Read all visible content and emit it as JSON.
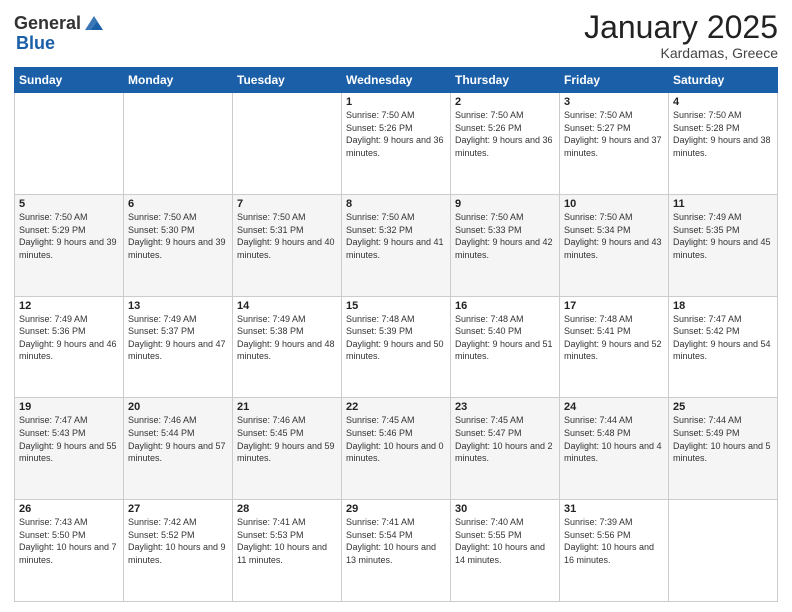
{
  "header": {
    "logo_general": "General",
    "logo_blue": "Blue",
    "title": "January 2025",
    "subtitle": "Kardamas, Greece"
  },
  "days_of_week": [
    "Sunday",
    "Monday",
    "Tuesday",
    "Wednesday",
    "Thursday",
    "Friday",
    "Saturday"
  ],
  "weeks": [
    [
      {
        "day": "",
        "info": ""
      },
      {
        "day": "",
        "info": ""
      },
      {
        "day": "",
        "info": ""
      },
      {
        "day": "1",
        "info": "Sunrise: 7:50 AM\nSunset: 5:26 PM\nDaylight: 9 hours\nand 36 minutes."
      },
      {
        "day": "2",
        "info": "Sunrise: 7:50 AM\nSunset: 5:26 PM\nDaylight: 9 hours\nand 36 minutes."
      },
      {
        "day": "3",
        "info": "Sunrise: 7:50 AM\nSunset: 5:27 PM\nDaylight: 9 hours\nand 37 minutes."
      },
      {
        "day": "4",
        "info": "Sunrise: 7:50 AM\nSunset: 5:28 PM\nDaylight: 9 hours\nand 38 minutes."
      }
    ],
    [
      {
        "day": "5",
        "info": "Sunrise: 7:50 AM\nSunset: 5:29 PM\nDaylight: 9 hours\nand 39 minutes."
      },
      {
        "day": "6",
        "info": "Sunrise: 7:50 AM\nSunset: 5:30 PM\nDaylight: 9 hours\nand 39 minutes."
      },
      {
        "day": "7",
        "info": "Sunrise: 7:50 AM\nSunset: 5:31 PM\nDaylight: 9 hours\nand 40 minutes."
      },
      {
        "day": "8",
        "info": "Sunrise: 7:50 AM\nSunset: 5:32 PM\nDaylight: 9 hours\nand 41 minutes."
      },
      {
        "day": "9",
        "info": "Sunrise: 7:50 AM\nSunset: 5:33 PM\nDaylight: 9 hours\nand 42 minutes."
      },
      {
        "day": "10",
        "info": "Sunrise: 7:50 AM\nSunset: 5:34 PM\nDaylight: 9 hours\nand 43 minutes."
      },
      {
        "day": "11",
        "info": "Sunrise: 7:49 AM\nSunset: 5:35 PM\nDaylight: 9 hours\nand 45 minutes."
      }
    ],
    [
      {
        "day": "12",
        "info": "Sunrise: 7:49 AM\nSunset: 5:36 PM\nDaylight: 9 hours\nand 46 minutes."
      },
      {
        "day": "13",
        "info": "Sunrise: 7:49 AM\nSunset: 5:37 PM\nDaylight: 9 hours\nand 47 minutes."
      },
      {
        "day": "14",
        "info": "Sunrise: 7:49 AM\nSunset: 5:38 PM\nDaylight: 9 hours\nand 48 minutes."
      },
      {
        "day": "15",
        "info": "Sunrise: 7:48 AM\nSunset: 5:39 PM\nDaylight: 9 hours\nand 50 minutes."
      },
      {
        "day": "16",
        "info": "Sunrise: 7:48 AM\nSunset: 5:40 PM\nDaylight: 9 hours\nand 51 minutes."
      },
      {
        "day": "17",
        "info": "Sunrise: 7:48 AM\nSunset: 5:41 PM\nDaylight: 9 hours\nand 52 minutes."
      },
      {
        "day": "18",
        "info": "Sunrise: 7:47 AM\nSunset: 5:42 PM\nDaylight: 9 hours\nand 54 minutes."
      }
    ],
    [
      {
        "day": "19",
        "info": "Sunrise: 7:47 AM\nSunset: 5:43 PM\nDaylight: 9 hours\nand 55 minutes."
      },
      {
        "day": "20",
        "info": "Sunrise: 7:46 AM\nSunset: 5:44 PM\nDaylight: 9 hours\nand 57 minutes."
      },
      {
        "day": "21",
        "info": "Sunrise: 7:46 AM\nSunset: 5:45 PM\nDaylight: 9 hours\nand 59 minutes."
      },
      {
        "day": "22",
        "info": "Sunrise: 7:45 AM\nSunset: 5:46 PM\nDaylight: 10 hours\nand 0 minutes."
      },
      {
        "day": "23",
        "info": "Sunrise: 7:45 AM\nSunset: 5:47 PM\nDaylight: 10 hours\nand 2 minutes."
      },
      {
        "day": "24",
        "info": "Sunrise: 7:44 AM\nSunset: 5:48 PM\nDaylight: 10 hours\nand 4 minutes."
      },
      {
        "day": "25",
        "info": "Sunrise: 7:44 AM\nSunset: 5:49 PM\nDaylight: 10 hours\nand 5 minutes."
      }
    ],
    [
      {
        "day": "26",
        "info": "Sunrise: 7:43 AM\nSunset: 5:50 PM\nDaylight: 10 hours\nand 7 minutes."
      },
      {
        "day": "27",
        "info": "Sunrise: 7:42 AM\nSunset: 5:52 PM\nDaylight: 10 hours\nand 9 minutes."
      },
      {
        "day": "28",
        "info": "Sunrise: 7:41 AM\nSunset: 5:53 PM\nDaylight: 10 hours\nand 11 minutes."
      },
      {
        "day": "29",
        "info": "Sunrise: 7:41 AM\nSunset: 5:54 PM\nDaylight: 10 hours\nand 13 minutes."
      },
      {
        "day": "30",
        "info": "Sunrise: 7:40 AM\nSunset: 5:55 PM\nDaylight: 10 hours\nand 14 minutes."
      },
      {
        "day": "31",
        "info": "Sunrise: 7:39 AM\nSunset: 5:56 PM\nDaylight: 10 hours\nand 16 minutes."
      },
      {
        "day": "",
        "info": ""
      }
    ]
  ]
}
